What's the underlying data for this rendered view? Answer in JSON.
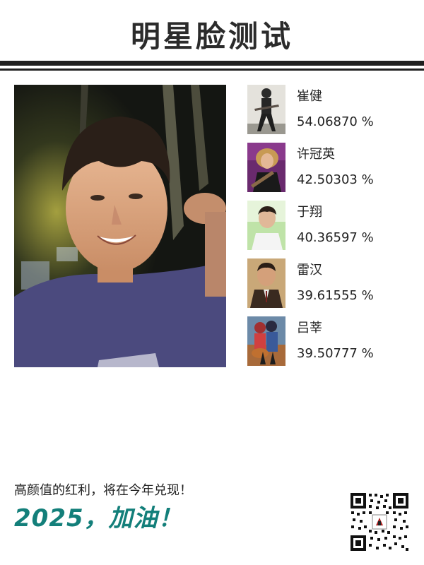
{
  "title": "明星脸测试",
  "results": [
    {
      "name": "崔健",
      "score": "54.06870 %",
      "thumb_icon": "singer-with-guitar-thumbnail"
    },
    {
      "name": "许冠英",
      "score": "42.50303 %",
      "thumb_icon": "actor-with-guitar-thumbnail"
    },
    {
      "name": "于翔",
      "score": "40.36597 %",
      "thumb_icon": "young-man-portrait-thumbnail"
    },
    {
      "name": "雷汉",
      "score": "39.61555 %",
      "thumb_icon": "man-in-suit-thumbnail"
    },
    {
      "name": "吕莘",
      "score": "39.50777 %",
      "thumb_icon": "couple-with-guitar-thumbnail"
    }
  ],
  "footer": {
    "line": "高颜值的红利，将在今年兑现！",
    "slogan": "2025，加油！"
  },
  "colors": {
    "accent": "#137f7a",
    "rule": "#1e1e1e",
    "text": "#222222"
  }
}
